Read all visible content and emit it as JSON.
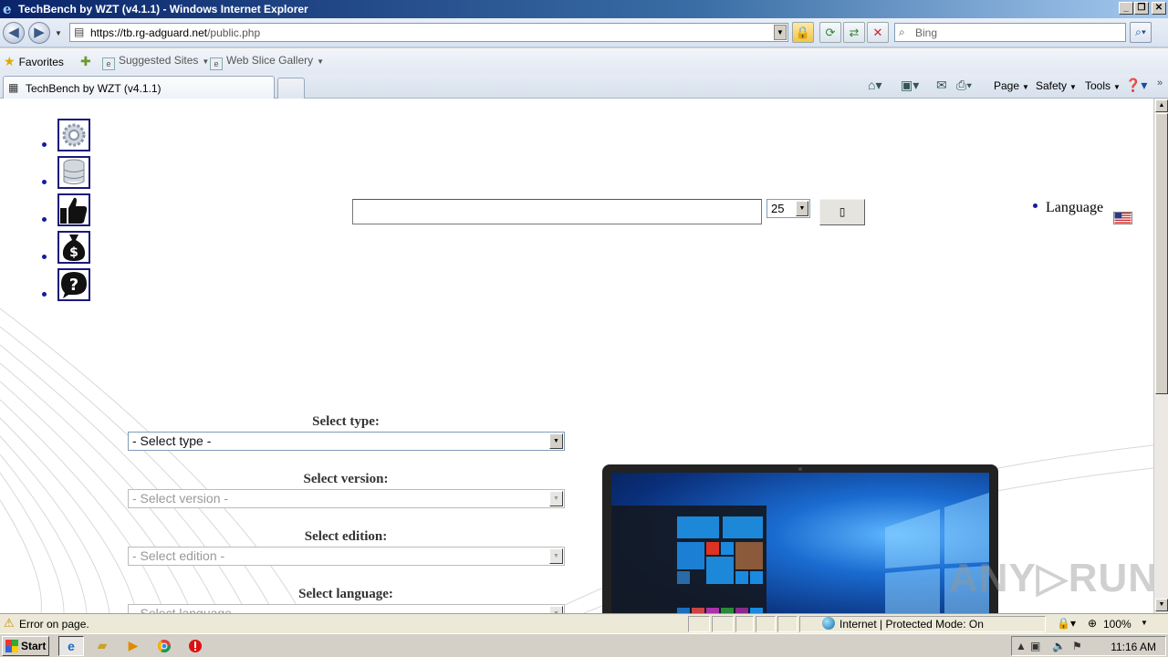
{
  "window": {
    "title": "TechBench by WZT (v4.1.1) - Windows Internet Explorer",
    "controls": [
      "_",
      "❐",
      "✕"
    ]
  },
  "address_bar": {
    "url_prefix": "https://tb.rg-adguard.net",
    "url_path": "/public.php",
    "search_placeholder": "Bing"
  },
  "favorites_bar": {
    "favorites_label": "Favorites",
    "items": [
      {
        "label": "Suggested Sites"
      },
      {
        "label": "Web Slice Gallery"
      }
    ]
  },
  "tabs": [
    {
      "label": "TechBench by WZT (v4.1.1)"
    }
  ],
  "command_bar": {
    "page_label": "Page",
    "safety_label": "Safety",
    "tools_label": "Tools"
  },
  "page": {
    "nav_icons": [
      "settings-gear",
      "database",
      "thumbs-up",
      "money-bag",
      "help-question"
    ],
    "search_value": "",
    "count_value": "25",
    "go_button_glyph": "▯",
    "language_label": "Language",
    "form": {
      "type_label": "Select type:",
      "type_value": "- Select type -",
      "version_label": "Select version:",
      "version_value": "- Select version -",
      "edition_label": "Select edition:",
      "edition_value": "- Select edition -",
      "language_label": "Select language:",
      "language_value": "- Select language -"
    },
    "watermark": "ANY▷RUN"
  },
  "status_bar": {
    "message": "Error on page.",
    "zone": "Internet | Protected Mode: On",
    "zoom": "100%"
  },
  "taskbar": {
    "start_label": "Start",
    "clock": "11:16 AM"
  },
  "colors": {
    "titlebar": "#0a246a",
    "nav_border": "#1a1a7a",
    "bullet": "#1a1a9a"
  }
}
